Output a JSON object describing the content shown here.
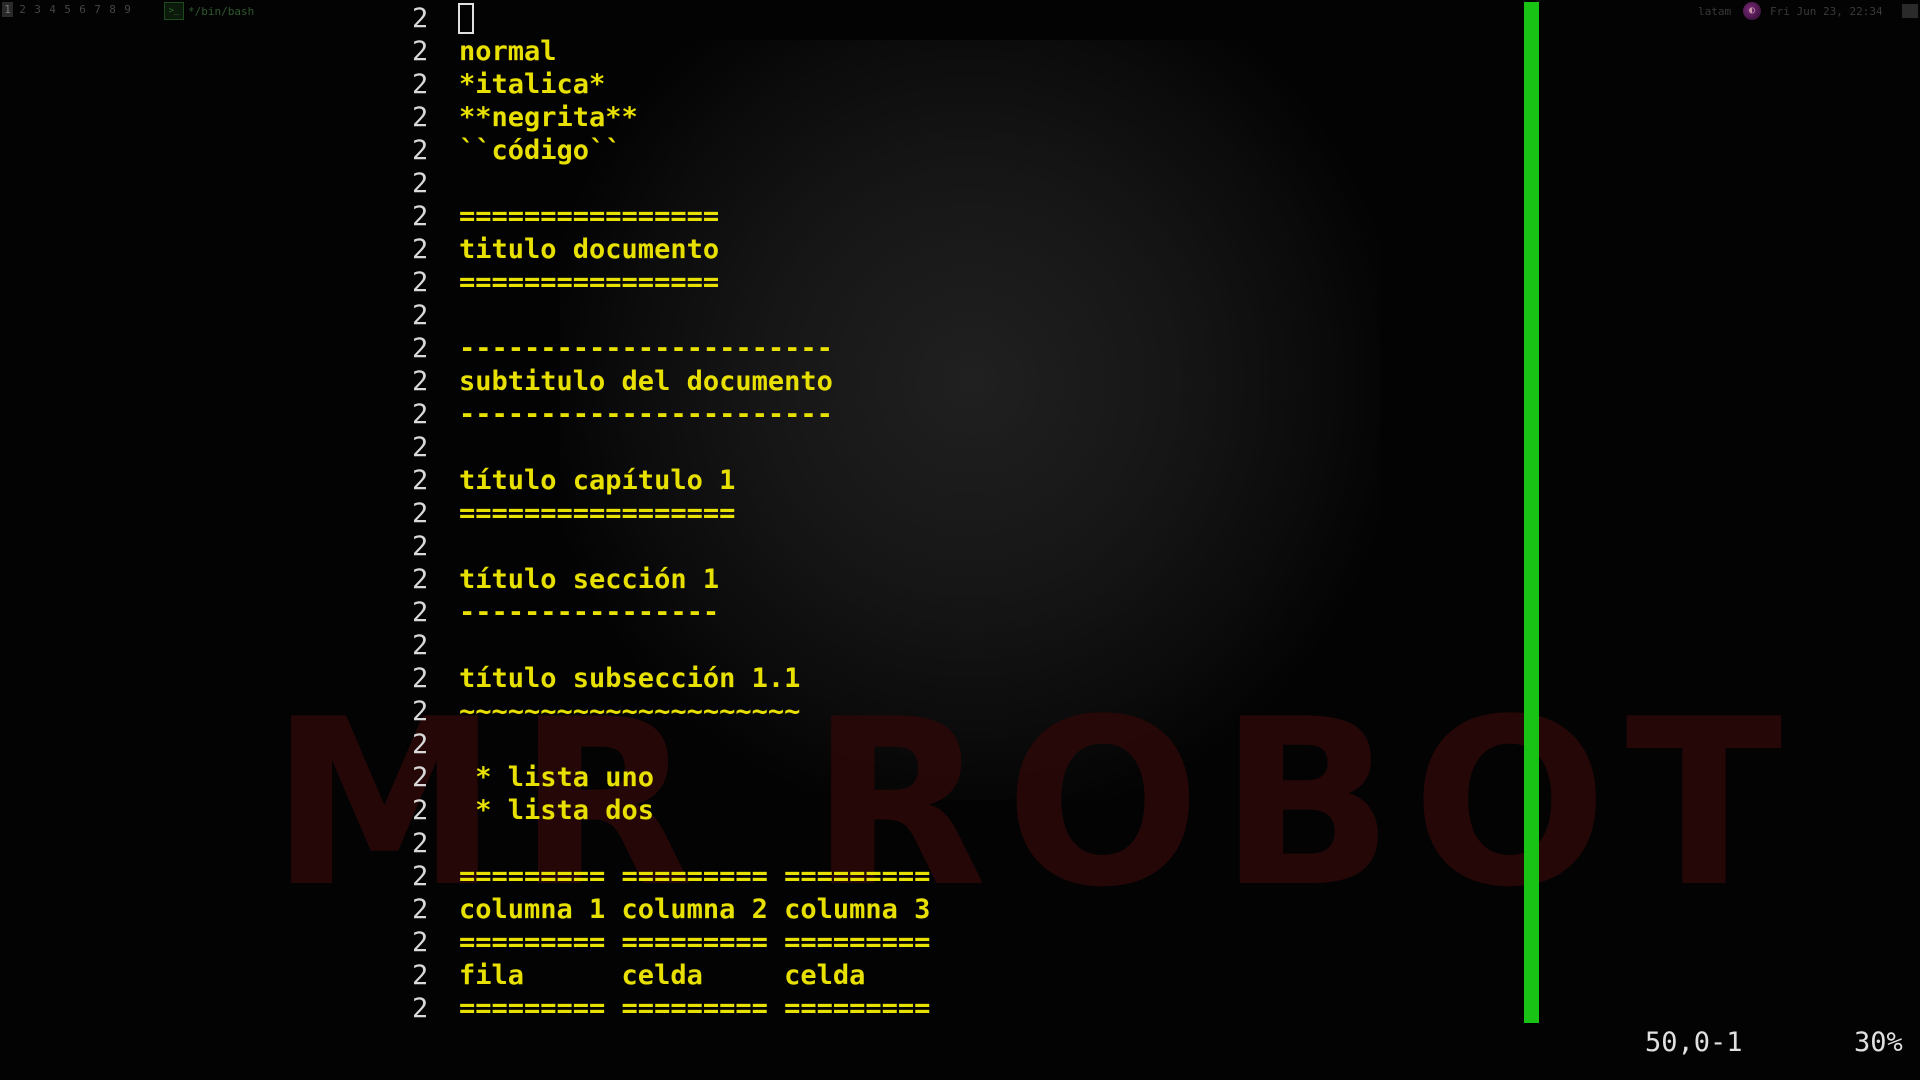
{
  "topbar": {
    "workspaces": [
      "1",
      "2",
      "3",
      "4",
      "5",
      "6",
      "7",
      "8",
      "9"
    ],
    "active_workspace": "1",
    "window_title": "*/bin/bash",
    "keyboard_layout": "latam",
    "clock": "Fri Jun 23, 22:34"
  },
  "editor": {
    "lines": [
      {
        "n": "2",
        "t": ""
      },
      {
        "n": "2",
        "t": "normal"
      },
      {
        "n": "2",
        "t": "*italica*"
      },
      {
        "n": "2",
        "t": "**negrita**"
      },
      {
        "n": "2",
        "t": "``código``"
      },
      {
        "n": "2",
        "t": ""
      },
      {
        "n": "2",
        "t": "================"
      },
      {
        "n": "2",
        "t": "titulo documento"
      },
      {
        "n": "2",
        "t": "================"
      },
      {
        "n": "2",
        "t": ""
      },
      {
        "n": "2",
        "t": "-----------------------"
      },
      {
        "n": "2",
        "t": "subtitulo del documento"
      },
      {
        "n": "2",
        "t": "-----------------------"
      },
      {
        "n": "2",
        "t": ""
      },
      {
        "n": "2",
        "t": "título capítulo 1"
      },
      {
        "n": "2",
        "t": "================="
      },
      {
        "n": "2",
        "t": ""
      },
      {
        "n": "2",
        "t": "título sección 1"
      },
      {
        "n": "2",
        "t": "----------------"
      },
      {
        "n": "2",
        "t": ""
      },
      {
        "n": "2",
        "t": "título subsección 1.1"
      },
      {
        "n": "2",
        "t": "~~~~~~~~~~~~~~~~~~~~~"
      },
      {
        "n": "2",
        "t": ""
      },
      {
        "n": "2",
        "t": " * lista uno"
      },
      {
        "n": "2",
        "t": " * lista dos"
      },
      {
        "n": "2",
        "t": ""
      },
      {
        "n": "2",
        "t": "========= ========= ========="
      },
      {
        "n": "2",
        "t": "columna 1 columna 2 columna 3"
      },
      {
        "n": "2",
        "t": "========= ========= ========="
      },
      {
        "n": "2",
        "t": "fila      celda     celda"
      },
      {
        "n": "2",
        "t": "========= ========= ========="
      }
    ]
  },
  "statusline": {
    "position": "50,0-1",
    "percent": "30%"
  },
  "colors": {
    "text": "#e8e000",
    "gutter": "#d9d9d9",
    "scrollbar": "#19c316",
    "background": "#030303"
  }
}
